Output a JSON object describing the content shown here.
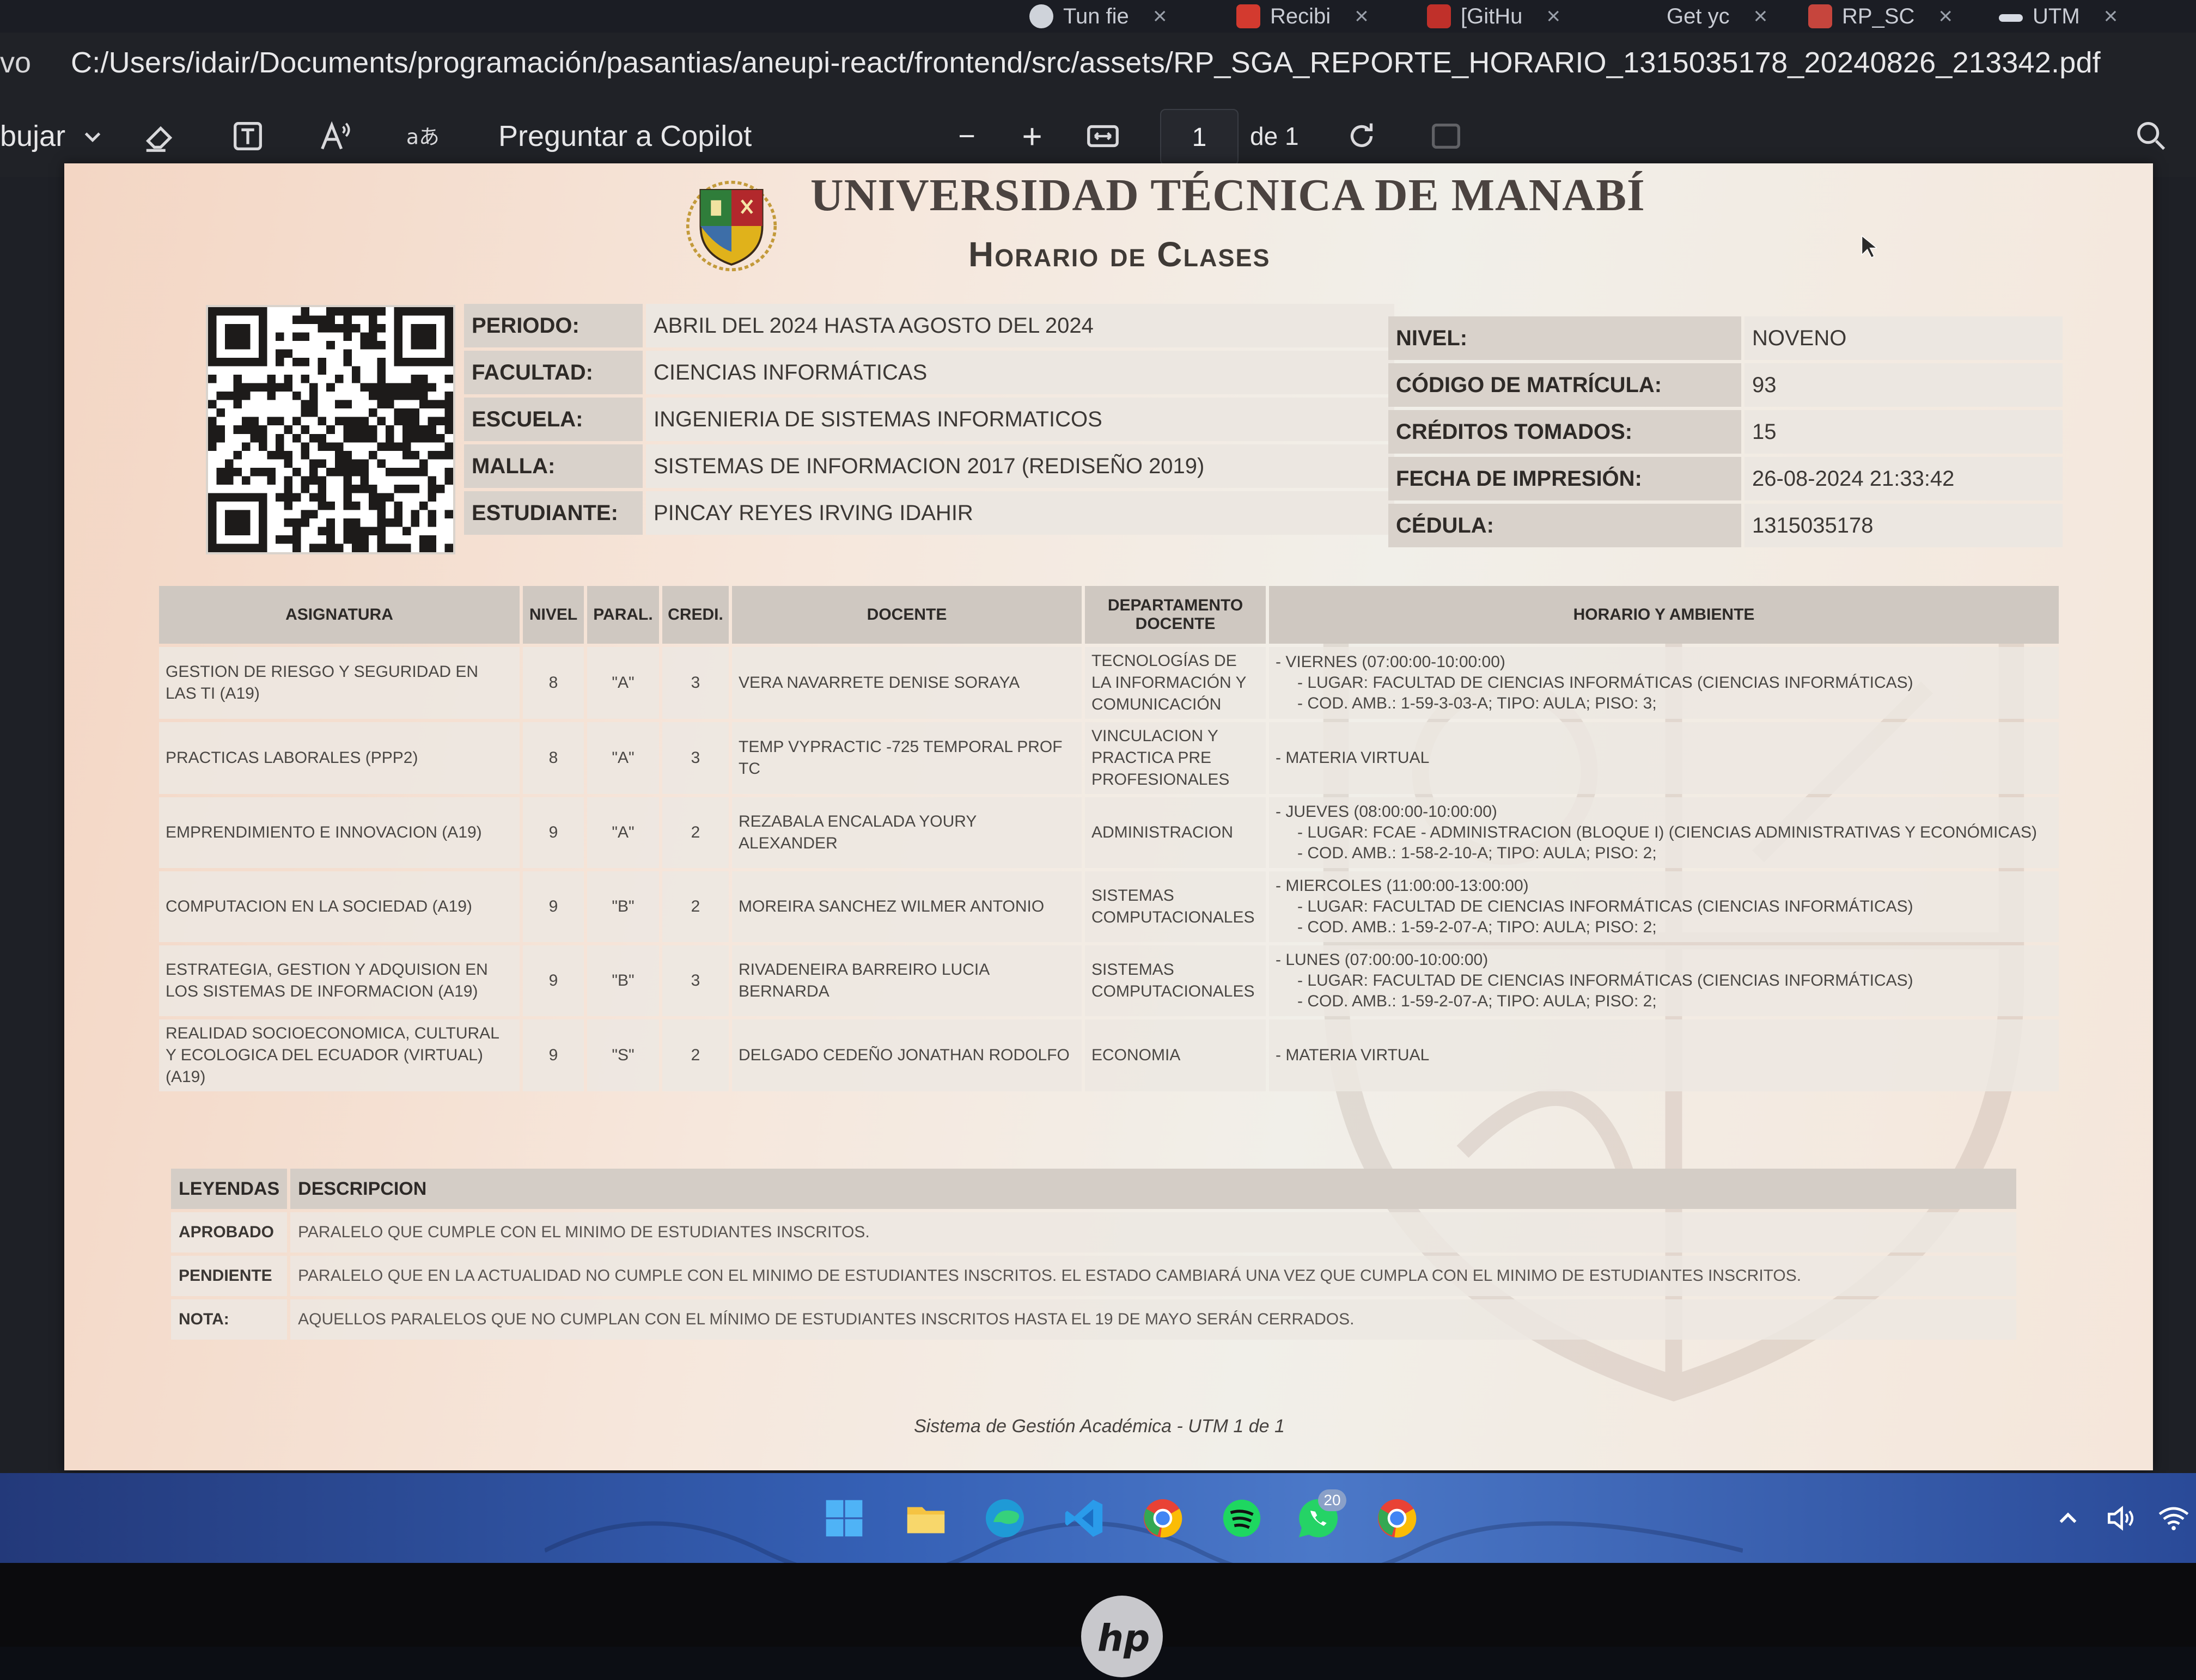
{
  "browser": {
    "tabs": [
      {
        "label": "Tun fie",
        "close": "×"
      },
      {
        "label": "Recibi",
        "close": "×"
      },
      {
        "label": "[GitHu",
        "close": "×"
      },
      {
        "label": "Get yc",
        "close": "×"
      },
      {
        "label": "RP_SC",
        "close": "×"
      },
      {
        "label": "UTM",
        "close": "×"
      }
    ],
    "address_prefix": "vo",
    "url": "C:/Users/idair/Documents/programación/pasantias/aneupi-react/frontend/src/assets/RP_SGA_REPORTE_HORARIO_1315035178_20240826_213342.pdf"
  },
  "pdf_toolbar": {
    "draw_label": "bujar",
    "copilot_label": "Preguntar a Copilot",
    "zoom_out": "−",
    "zoom_in": "+",
    "page_current": "1",
    "page_total": "de 1",
    "icons": [
      "chevron-down-icon",
      "eraser-icon",
      "text-box-icon",
      "read-aloud-icon",
      "translate-icon",
      "fit-width-icon",
      "rotate-icon",
      "search-icon"
    ]
  },
  "document": {
    "university": "UNIVERSIDAD TÉCNICA DE MANABÍ",
    "title": "Horario de Clases",
    "info_left": [
      {
        "label": "PERIODO:",
        "value": "ABRIL DEL 2024 HASTA AGOSTO DEL 2024"
      },
      {
        "label": "FACULTAD:",
        "value": "CIENCIAS INFORMÁTICAS"
      },
      {
        "label": "ESCUELA:",
        "value": "INGENIERIA DE SISTEMAS INFORMATICOS"
      },
      {
        "label": "MALLA:",
        "value": "SISTEMAS DE INFORMACION 2017 (REDISEÑO 2019)"
      },
      {
        "label": "ESTUDIANTE:",
        "value": "PINCAY REYES IRVING IDAHIR"
      }
    ],
    "info_right": [
      {
        "label": "NIVEL:",
        "value": "NOVENO"
      },
      {
        "label": "CÓDIGO DE MATRÍCULA:",
        "value": "93"
      },
      {
        "label": "CRÉDITOS TOMADOS:",
        "value": "15"
      },
      {
        "label": "FECHA DE IMPRESIÓN:",
        "value": "26-08-2024 21:33:42"
      },
      {
        "label": "CÉDULA:",
        "value": "1315035178"
      }
    ],
    "schedule_headers": [
      "ASIGNATURA",
      "NIVEL",
      "PARAL.",
      "CREDI.",
      "DOCENTE",
      "DEPARTAMENTO DOCENTE",
      "HORARIO Y AMBIENTE"
    ],
    "schedule_rows": [
      {
        "asignatura": "GESTION DE RIESGO Y SEGURIDAD EN LAS TI (A19)",
        "nivel": "8",
        "paralelo": "\"A\"",
        "creditos": "3",
        "docente": "VERA NAVARRETE DENISE SORAYA",
        "departamento": "TECNOLOGÍAS DE LA INFORMACIÓN Y COMUNICACIÓN",
        "horario": [
          "- VIERNES (07:00:00-10:00:00)",
          "- LUGAR: FACULTAD DE CIENCIAS INFORMÁTICAS (CIENCIAS INFORMÁTICAS)",
          "- COD. AMB.: 1-59-3-03-A; TIPO: AULA; PISO: 3;"
        ]
      },
      {
        "asignatura": "PRACTICAS LABORALES (PPP2)",
        "nivel": "8",
        "paralelo": "\"A\"",
        "creditos": "3",
        "docente": "TEMP VYPRACTIC -725 TEMPORAL PROF TC",
        "departamento": "VINCULACION Y PRACTICA PRE PROFESIONALES",
        "horario": [
          "- MATERIA VIRTUAL"
        ]
      },
      {
        "asignatura": "EMPRENDIMIENTO E INNOVACION (A19)",
        "nivel": "9",
        "paralelo": "\"A\"",
        "creditos": "2",
        "docente": "REZABALA ENCALADA YOURY ALEXANDER",
        "departamento": "ADMINISTRACION",
        "horario": [
          "- JUEVES (08:00:00-10:00:00)",
          "- LUGAR: FCAE - ADMINISTRACION (BLOQUE I) (CIENCIAS ADMINISTRATIVAS Y ECONÓMICAS)",
          "- COD. AMB.: 1-58-2-10-A; TIPO: AULA; PISO: 2;"
        ]
      },
      {
        "asignatura": "COMPUTACION EN LA SOCIEDAD (A19)",
        "nivel": "9",
        "paralelo": "\"B\"",
        "creditos": "2",
        "docente": "MOREIRA SANCHEZ WILMER ANTONIO",
        "departamento": "SISTEMAS COMPUTACIONALES",
        "horario": [
          "- MIERCOLES (11:00:00-13:00:00)",
          "- LUGAR: FACULTAD DE CIENCIAS INFORMÁTICAS (CIENCIAS INFORMÁTICAS)",
          "- COD. AMB.: 1-59-2-07-A; TIPO: AULA; PISO: 2;"
        ]
      },
      {
        "asignatura": "ESTRATEGIA, GESTION Y ADQUISION EN LOS SISTEMAS DE INFORMACION (A19)",
        "nivel": "9",
        "paralelo": "\"B\"",
        "creditos": "3",
        "docente": "RIVADENEIRA BARREIRO LUCIA BERNARDA",
        "departamento": "SISTEMAS COMPUTACIONALES",
        "horario": [
          "- LUNES (07:00:00-10:00:00)",
          "- LUGAR: FACULTAD DE CIENCIAS INFORMÁTICAS (CIENCIAS INFORMÁTICAS)",
          "- COD. AMB.: 1-59-2-07-A; TIPO: AULA; PISO: 2;"
        ]
      },
      {
        "asignatura": "REALIDAD SOCIOECONOMICA, CULTURAL Y ECOLOGICA DEL ECUADOR (VIRTUAL) (A19)",
        "nivel": "9",
        "paralelo": "\"S\"",
        "creditos": "2",
        "docente": "DELGADO CEDEÑO JONATHAN RODOLFO",
        "departamento": "ECONOMIA",
        "horario": [
          "- MATERIA VIRTUAL"
        ]
      }
    ],
    "legend_headers": [
      "LEYENDAS",
      "DESCRIPCION"
    ],
    "legend_rows": [
      {
        "key": "APROBADO",
        "desc": "PARALELO QUE CUMPLE CON EL MINIMO DE ESTUDIANTES INSCRITOS."
      },
      {
        "key": "PENDIENTE",
        "desc": "PARALELO QUE EN LA ACTUALIDAD NO CUMPLE CON EL MINIMO DE ESTUDIANTES INSCRITOS. EL ESTADO CAMBIARÁ UNA VEZ QUE CUMPLA CON EL MINIMO DE ESTUDIANTES INSCRITOS."
      },
      {
        "key": "NOTA:",
        "desc": "AQUELLOS PARALELOS QUE NO CUMPLAN CON EL MÍNIMO DE ESTUDIANTES INSCRITOS HASTA EL 19 DE MAYO SERÁN CERRADOS."
      }
    ],
    "footer": "Sistema de Gestión Académica - UTM 1 de 1"
  },
  "taskbar": {
    "apps": [
      "windows-start-icon",
      "file-explorer-icon",
      "edge-icon",
      "vscode-icon",
      "chrome-icon",
      "spotify-icon",
      "whatsapp-icon",
      "chrome-icon"
    ],
    "whatsapp_badge": "20",
    "tray_icons": [
      "chevron-up-icon",
      "volume-icon",
      "wifi-icon"
    ]
  },
  "laptop_brand": "hp",
  "colors": {
    "accent_blue": "#3560b5",
    "crest_red": "#b2282c",
    "crest_green": "#2f7d3a",
    "crest_yellow": "#e0b21b"
  }
}
